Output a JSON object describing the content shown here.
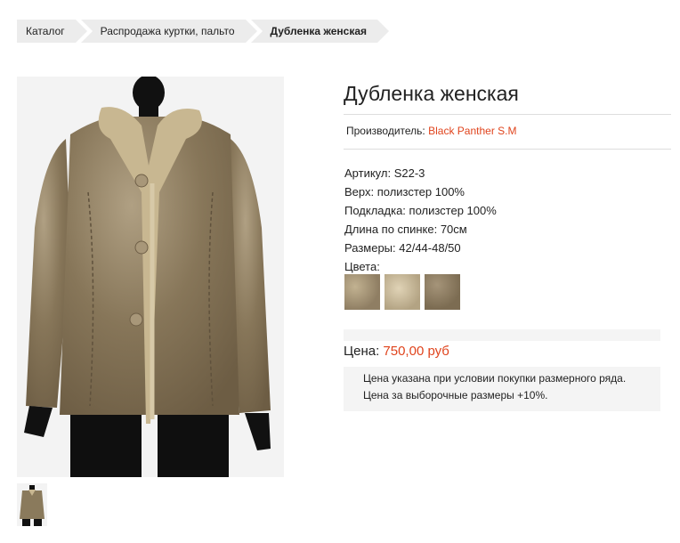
{
  "breadcrumb": {
    "items": [
      "Каталог",
      "Распродажа куртки, пальто",
      "Дубленка женская"
    ]
  },
  "product": {
    "title": "Дубленка женская",
    "manufacturer_label": "Производитель:",
    "manufacturer_value": "Black Panther S.M",
    "specs": [
      "Артикул: S22-3",
      "Верх: полизстер 100%",
      "Подкладка: полизстер 100%",
      "Длина по спинке: 70см",
      "Размеры: 42/44-48/50",
      "Цвета:"
    ],
    "price_label": "Цена:",
    "price_value": "750,00 руб",
    "notes": [
      "Цена указана при условии покупки размерного ряда.",
      "Цена за выборочные размеры +10%."
    ]
  },
  "colors": {
    "accent": "#e0441d",
    "swatches": [
      "#9c8b70",
      "#c7b89a",
      "#8f7e63"
    ]
  }
}
